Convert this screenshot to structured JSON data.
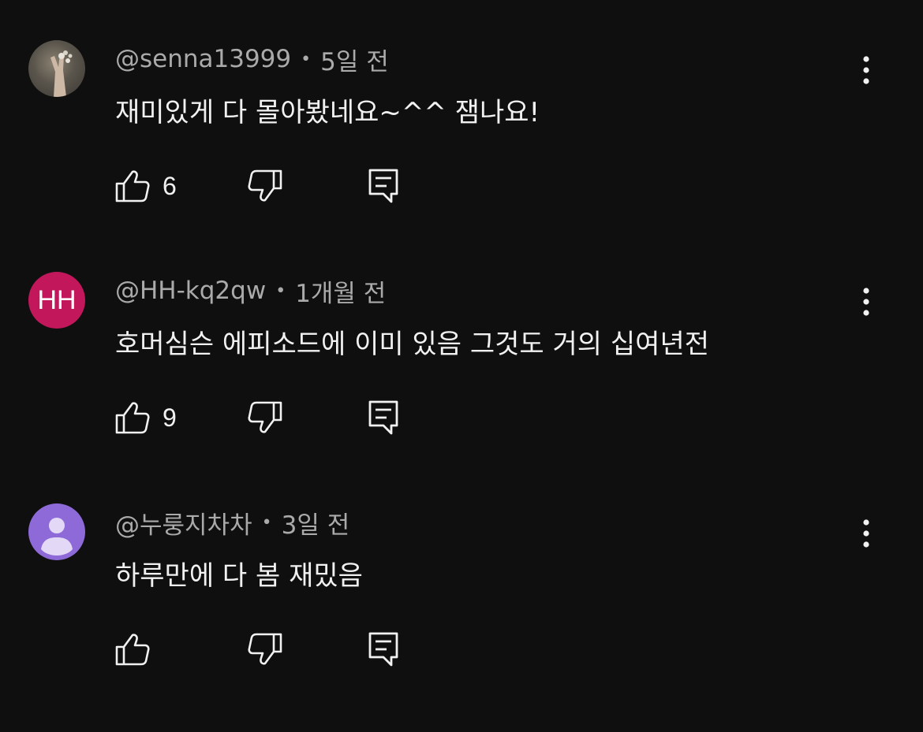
{
  "comments": [
    {
      "avatar_type": "photo",
      "avatar_initials": "",
      "avatar_color": "#5a554c",
      "author": "@senna13999",
      "separator": "•",
      "time": "5일 전",
      "text": "재미있게  다 몰아봤네요~^^ 잼나요!",
      "like_count": "6"
    },
    {
      "avatar_type": "initials",
      "avatar_initials": "HH",
      "avatar_color": "#c2185b",
      "author": "@HH-kq2qw",
      "separator": "•",
      "time": "1개월 전",
      "text": "호머심슨 에피소드에 이미 있음 그것도 거의 십여년전",
      "like_count": "9"
    },
    {
      "avatar_type": "default-user",
      "avatar_initials": "",
      "avatar_color": "#8e6ad8",
      "author": "@누룽지차차",
      "separator": "•",
      "time": "3일 전",
      "text": "하루만에 다 봄 재밌음",
      "like_count": ""
    }
  ],
  "icons": {
    "like": "thumbs-up-icon",
    "dislike": "thumbs-down-icon",
    "reply": "reply-icon",
    "more": "more-vertical-icon"
  },
  "colors": {
    "background": "#0f0f0f",
    "text_primary": "#f1f1f1",
    "text_secondary": "#aaaaaa"
  }
}
